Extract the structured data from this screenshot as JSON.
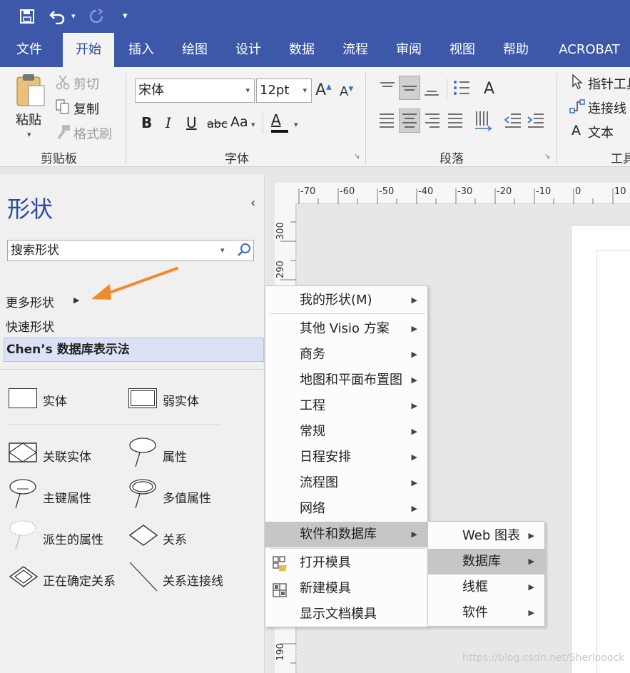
{
  "quick_access": {
    "save_icon": "save-icon",
    "undo_icon": "undo-icon",
    "redo_icon": "redo-icon",
    "customize": "▾"
  },
  "tabs": [
    "文件",
    "开始",
    "插入",
    "绘图",
    "设计",
    "数据",
    "流程",
    "审阅",
    "视图",
    "帮助",
    "ACROBAT"
  ],
  "active_tab": "开始",
  "clipboard": {
    "paste": "粘贴",
    "cut": "剪切",
    "copy": "复制",
    "format_painter": "格式刷",
    "group_label": "剪贴板"
  },
  "font": {
    "name": "宋体",
    "size": "12pt",
    "bold": "B",
    "italic": "I",
    "underline": "U",
    "strike": "abc",
    "case": "Aa",
    "color_letter": "A",
    "group_label": "字体"
  },
  "paragraph": {
    "group_label": "段落"
  },
  "tools": {
    "pointer": "指针工具",
    "connector": "连接线",
    "text": "文本",
    "group_label": "工具"
  },
  "shapes_panel": {
    "title": "形状",
    "search_placeholder": "搜索形状",
    "more_shapes": "更多形状",
    "quick_shapes": "快速形状",
    "selected_stencil": "Chen’s 数据库表示法",
    "shapes": [
      {
        "label": "实体",
        "icon": "entity-icon"
      },
      {
        "label": "弱实体",
        "icon": "weak-entity-icon"
      },
      {
        "label": "关联实体",
        "icon": "associative-entity-icon"
      },
      {
        "label": "属性",
        "icon": "attribute-icon"
      },
      {
        "label": "主键属性",
        "icon": "primary-key-attribute-icon"
      },
      {
        "label": "多值属性",
        "icon": "multivalued-attribute-icon"
      },
      {
        "label": "派生的属性",
        "icon": "derived-attribute-icon"
      },
      {
        "label": "关系",
        "icon": "relationship-icon"
      },
      {
        "label": "正在确定关系",
        "icon": "identifying-relationship-icon"
      },
      {
        "label": "关系连接线",
        "icon": "relationship-connector-icon"
      }
    ]
  },
  "ruler": {
    "horizontal": [
      "-70",
      "-60",
      "-50",
      "-40",
      "-30",
      "-20",
      "-10",
      "0",
      "10"
    ],
    "vertical": [
      "300",
      "290",
      "190"
    ]
  },
  "menu1": [
    {
      "label": "我的形状(M)",
      "arrow": true
    },
    {
      "label": "其他 Visio 方案",
      "arrow": true
    },
    {
      "label": "商务",
      "arrow": true
    },
    {
      "label": "地图和平面布置图",
      "arrow": true
    },
    {
      "label": "工程",
      "arrow": true
    },
    {
      "label": "常规",
      "arrow": true
    },
    {
      "label": "日程安排",
      "arrow": true
    },
    {
      "label": "流程图",
      "arrow": true
    },
    {
      "label": "网络",
      "arrow": true
    },
    {
      "label": "软件和数据库",
      "arrow": true,
      "highlight": true
    },
    {
      "label": "打开模具",
      "icon": "open-stencil-icon"
    },
    {
      "label": "新建模具",
      "icon": "new-stencil-icon"
    },
    {
      "label": "显示文档模具"
    }
  ],
  "menu2": [
    {
      "label": "Web 图表",
      "arrow": true
    },
    {
      "label": "数据库",
      "arrow": true,
      "highlight": true
    },
    {
      "label": "线框",
      "arrow": true
    },
    {
      "label": "软件",
      "arrow": true
    }
  ],
  "watermark": "https://blog.csdn.net/Sherlooock",
  "colors": {
    "ribbon_blue": "#3d58a8",
    "highlight": "#c6c6c6",
    "arrow_orange": "#f08a2c",
    "selected_stencil": "#dce2f5"
  }
}
